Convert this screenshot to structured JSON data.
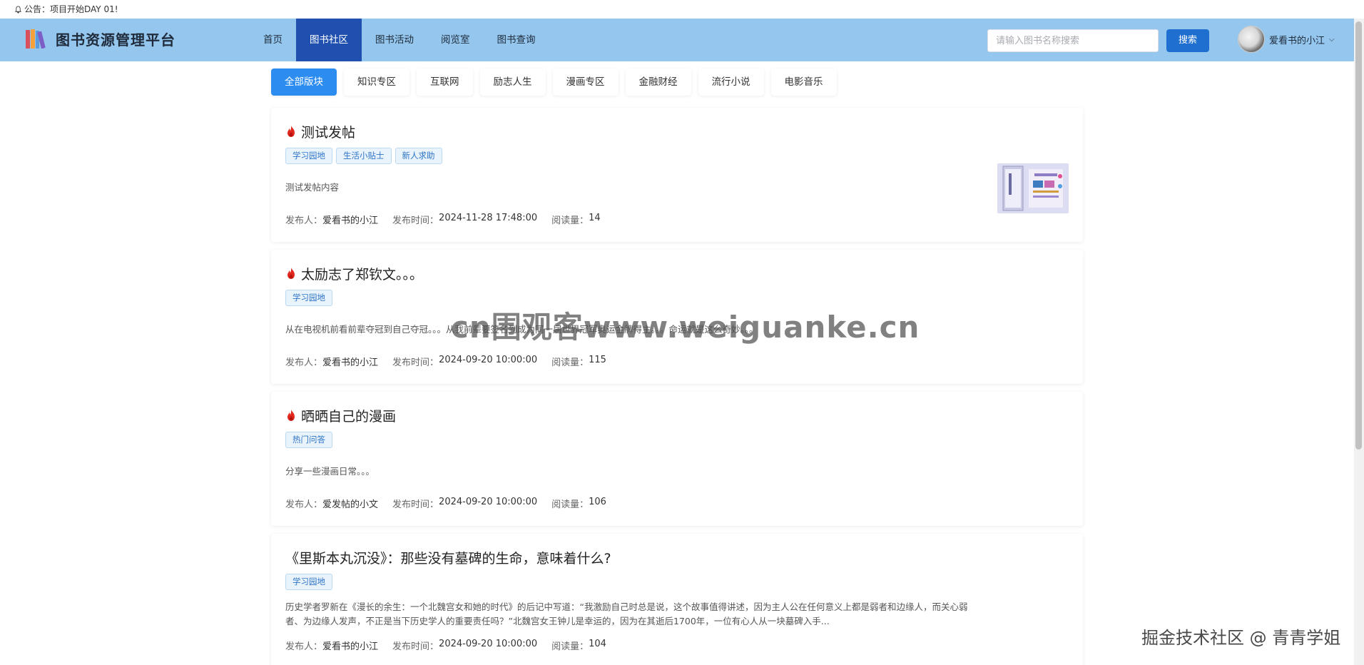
{
  "announcement": {
    "text": "公告：项目开始DAY 01!"
  },
  "header": {
    "brand": "图书资源管理平台",
    "nav": [
      {
        "label": "首页",
        "active": false
      },
      {
        "label": "图书社区",
        "active": true
      },
      {
        "label": "图书活动",
        "active": false
      },
      {
        "label": "阅览室",
        "active": false
      },
      {
        "label": "图书查询",
        "active": false
      }
    ],
    "search": {
      "placeholder": "请输入图书名称搜索",
      "value": ""
    },
    "search_button": "搜索",
    "user": {
      "name": "爱看书的小江",
      "menu_icon": "chevron-down-icon"
    }
  },
  "tabs": [
    {
      "label": "全部版块",
      "active": true
    },
    {
      "label": "知识专区",
      "active": false
    },
    {
      "label": "互联网",
      "active": false
    },
    {
      "label": "励志人生",
      "active": false
    },
    {
      "label": "漫画专区",
      "active": false
    },
    {
      "label": "金融财经",
      "active": false
    },
    {
      "label": "流行小说",
      "active": false
    },
    {
      "label": "电影音乐",
      "active": false
    }
  ],
  "meta_labels": {
    "author": "发布人：",
    "time": "发布时间：",
    "views": "阅读量："
  },
  "posts": [
    {
      "hot": true,
      "title": "测试发帖",
      "tags": [
        "学习园地",
        "生活小贴士",
        "新人求助"
      ],
      "content": "测试发帖内容",
      "author": "爱看书的小江",
      "time": "2024-11-28 17:48:00",
      "views": "14",
      "has_thumbnail": true
    },
    {
      "hot": true,
      "title": "太励志了郑钦文。。。",
      "tags": [
        "学习园地"
      ],
      "content": "从在电视机前看前辈夺冠到自己夺冠。。。从我前辈要签名到成为同一届世界冠军奥运金牌得主。。。命运就是这么奇妙。。。",
      "author": "爱看书的小江",
      "time": "2024-09-20 10:00:00",
      "views": "115",
      "has_thumbnail": false
    },
    {
      "hot": true,
      "title": "晒晒自己的漫画",
      "tags": [
        "热门问答"
      ],
      "content": "分享一些漫画日常。。。",
      "author": "爱发帖的小文",
      "time": "2024-09-20 10:00:00",
      "views": "106",
      "has_thumbnail": false
    },
    {
      "hot": false,
      "title": "《里斯本丸沉没》：那些没有墓碑的生命，意味着什么?",
      "tags": [
        "学习园地"
      ],
      "content": "历史学者罗新在《漫长的余生：一个北魏宫女和她的时代》的后记中写道：“我激励自己时总是说，这个故事值得讲述，因为主人公在任何意义上都是弱者和边缘人，而关心弱者、为边缘人发声，不正是当下历史学人的重要责任吗？”北魏宫女王钟儿是幸运的，因为在其逝后1700年，一位有心人从一块墓碑入手...",
      "author": "爱看书的小江",
      "time": "2024-09-20 10:00:00",
      "views": "104",
      "has_thumbnail": false
    }
  ],
  "watermarks": {
    "center": "cn围观客www.weiguanke.cn",
    "corner": "掘金技术社区 @ 青青学姐"
  },
  "colors": {
    "header_bg": "#94c6ee",
    "nav_active": "#1f50b0",
    "tab_active": "#2d8cf0",
    "search_button": "#1f6fd1",
    "hot_icon": "#e0281e"
  }
}
